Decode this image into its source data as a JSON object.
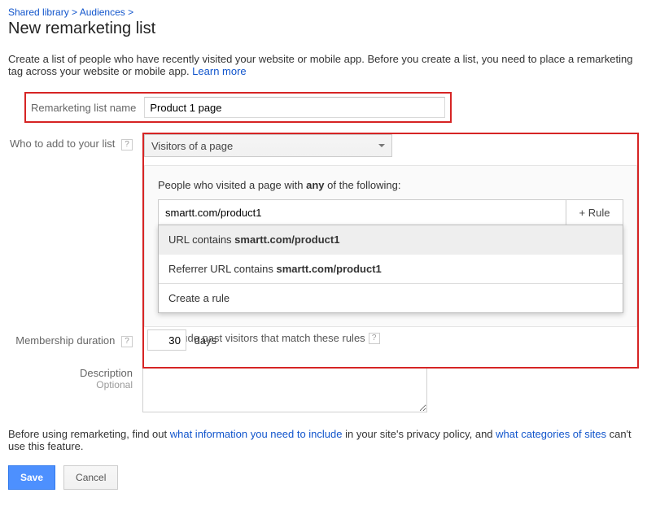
{
  "breadcrumb": {
    "shared": "Shared library",
    "aud": "Audiences",
    "sep": ">"
  },
  "page_title": "New remarketing list",
  "intro": {
    "text": "Create a list of people who have recently visited your website or mobile app. Before you create a list, you need to place a remarketing tag across your website or mobile app. ",
    "learn_more": "Learn more"
  },
  "name": {
    "label": "Remarketing list name",
    "value": "Product 1 page"
  },
  "who": {
    "label": "Who to add to your list",
    "help": "?",
    "dropdown": "Visitors of a page"
  },
  "rules": {
    "prefix": "People who visited a page with ",
    "bold": "any",
    "suffix": " of the following:",
    "url_value": "smartt.com/product1",
    "rule_btn": "+ Rule",
    "sugg1_a": "URL contains ",
    "sugg1_b": "smartt.com/product1",
    "sugg2_a": "Referrer URL contains ",
    "sugg2_b": "smartt.com/product1",
    "create": "Create a rule"
  },
  "past": {
    "label": "Include past visitors that match these rules",
    "help": "?"
  },
  "membership": {
    "label": "Membership duration",
    "help": "?",
    "value": "30",
    "unit": "days"
  },
  "description": {
    "label": "Description",
    "optional": "Optional"
  },
  "footer": {
    "a": "Before using remarketing, find out ",
    "link1": "what information you need to include",
    "b": " in your site's privacy policy, and ",
    "link2": "what categories of sites",
    "c": " can't use this feature."
  },
  "buttons": {
    "save": "Save",
    "cancel": "Cancel"
  }
}
